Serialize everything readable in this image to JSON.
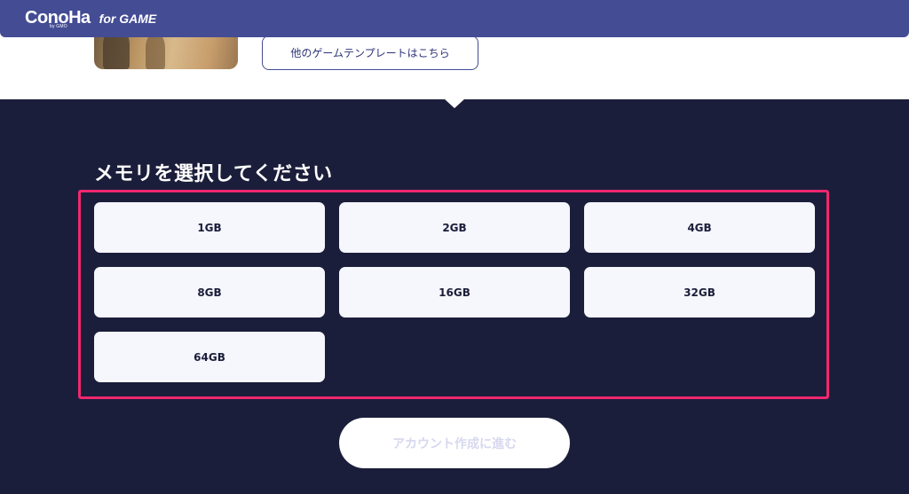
{
  "header": {
    "logo_text": "ConoHa",
    "logo_byline": "by GMO",
    "logo_tag": "for GAME",
    "accent_color": "#444c94"
  },
  "template": {
    "more_templates_label": "他のゲームテンプレートはこちら"
  },
  "memory": {
    "title": "メモリを選択してください",
    "highlight_color": "#f0286f",
    "options": [
      "1GB",
      "2GB",
      "4GB",
      "8GB",
      "16GB",
      "32GB",
      "64GB"
    ]
  },
  "actions": {
    "proceed_label": "アカウント作成に進む",
    "proceed_disabled": true
  },
  "colors": {
    "dark_background": "#1b1e3a",
    "option_background": "#f6f6fd"
  }
}
